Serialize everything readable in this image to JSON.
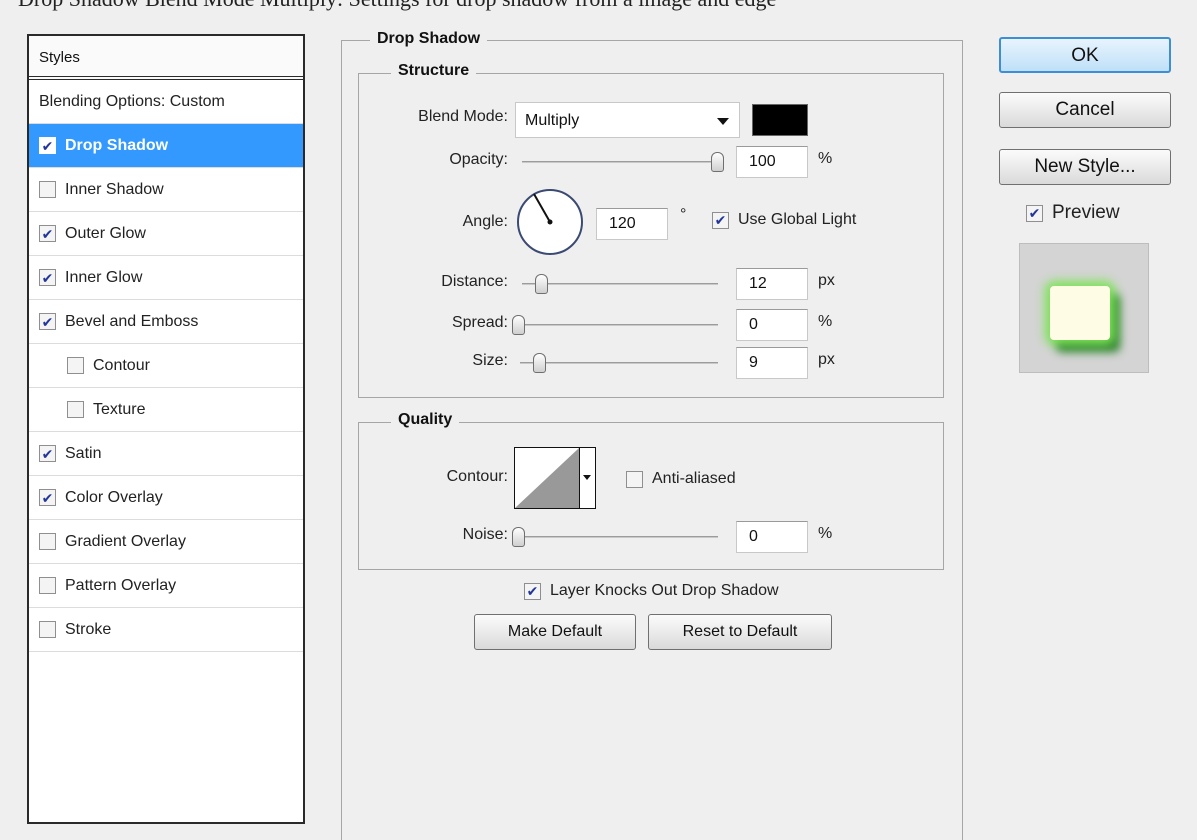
{
  "caption": "Drop Shadow Blend Mode Multiply: Settings for drop shadow from a image and edge",
  "styles_panel": {
    "header": "Styles",
    "blending_options": "Blending Options: Custom",
    "items": [
      {
        "label": "Drop Shadow",
        "checked": true
      },
      {
        "label": "Inner Shadow",
        "checked": false
      },
      {
        "label": "Outer Glow",
        "checked": true
      },
      {
        "label": "Inner Glow",
        "checked": true
      },
      {
        "label": "Bevel and Emboss",
        "checked": true
      },
      {
        "label": "Contour",
        "checked": false
      },
      {
        "label": "Texture",
        "checked": false
      },
      {
        "label": "Satin",
        "checked": true
      },
      {
        "label": "Color Overlay",
        "checked": true
      },
      {
        "label": "Gradient Overlay",
        "checked": false
      },
      {
        "label": "Pattern Overlay",
        "checked": false
      },
      {
        "label": "Stroke",
        "checked": false
      }
    ]
  },
  "drop_shadow": {
    "title": "Drop Shadow",
    "structure": {
      "title": "Structure",
      "blend_mode_label": "Blend Mode:",
      "blend_mode_value": "Multiply",
      "shadow_color": "#000000",
      "opacity_label": "Opacity:",
      "opacity_value": "100",
      "opacity_unit": "%",
      "opacity_level": 1.0,
      "angle_label": "Angle:",
      "angle_value": "120",
      "angle_unit": "°",
      "use_global_light_label": "Use Global Light",
      "use_global_light_checked": true,
      "distance_label": "Distance:",
      "distance_value": "12",
      "distance_unit": "px",
      "spread_label": "Spread:",
      "spread_value": "0",
      "spread_unit": "%",
      "size_label": "Size:",
      "size_value": "9",
      "size_unit": "px"
    },
    "quality": {
      "title": "Quality",
      "contour_label": "Contour:",
      "anti_aliased_label": "Anti-aliased",
      "anti_aliased_checked": false,
      "noise_label": "Noise:",
      "noise_value": "0",
      "noise_unit": "%"
    },
    "knockout_label": "Layer Knocks Out Drop Shadow",
    "knockout_checked": true,
    "make_default_label": "Make Default",
    "reset_default_label": "Reset to Default"
  },
  "dialog_buttons": {
    "ok": "OK",
    "cancel": "Cancel",
    "new_style": "New Style...",
    "preview_label": "Preview",
    "preview_checked": true
  }
}
